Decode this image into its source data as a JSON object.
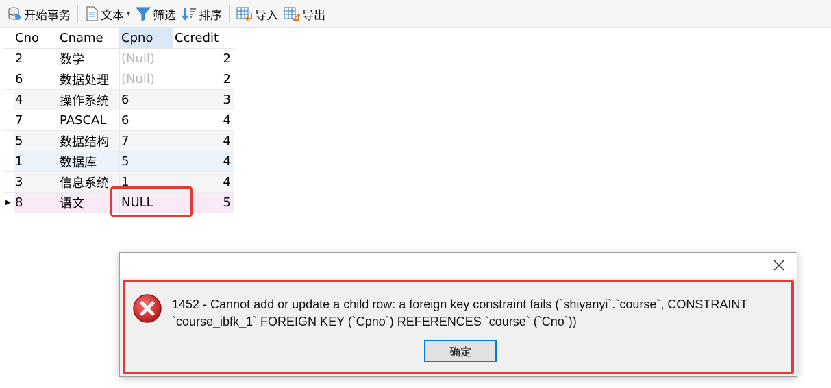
{
  "toolbar": {
    "begin_transaction": "开始事务",
    "text": "文本",
    "filter": "筛选",
    "sort": "排序",
    "import": "导入",
    "export": "导出"
  },
  "grid": {
    "columns": [
      "Cno",
      "Cname",
      "Cpno",
      "Ccredit"
    ],
    "rows": [
      {
        "cno": "2",
        "cname": "数学",
        "cpno": "(Null)",
        "ccredit": "2"
      },
      {
        "cno": "6",
        "cname": "数据处理",
        "cpno": "(Null)",
        "ccredit": "2"
      },
      {
        "cno": "4",
        "cname": "操作系统",
        "cpno": "6",
        "ccredit": "3"
      },
      {
        "cno": "7",
        "cname": "PASCAL",
        "cpno": "6",
        "ccredit": "4"
      },
      {
        "cno": "5",
        "cname": "数据结构",
        "cpno": "7",
        "ccredit": "4"
      },
      {
        "cno": "1",
        "cname": "数据库",
        "cpno": "5",
        "ccredit": "4"
      },
      {
        "cno": "3",
        "cname": "信息系统",
        "cpno": "1",
        "ccredit": "4"
      },
      {
        "cno": "8",
        "cname": "语文",
        "cpno": "NULL",
        "ccredit": "5"
      }
    ]
  },
  "dialog": {
    "message_line1": "1452 - Cannot add or update a child row: a foreign key constraint fails (`shiyanyi`.`course`, CONSTRAINT",
    "message_line2": "`course_ibfk_1` FOREIGN KEY (`Cpno`) REFERENCES `course` (`Cno`))",
    "ok_label": "确定"
  },
  "colors": {
    "highlight_red": "#e53935",
    "accent_blue": "#0078d7",
    "current_row": "#f7e9f6"
  }
}
